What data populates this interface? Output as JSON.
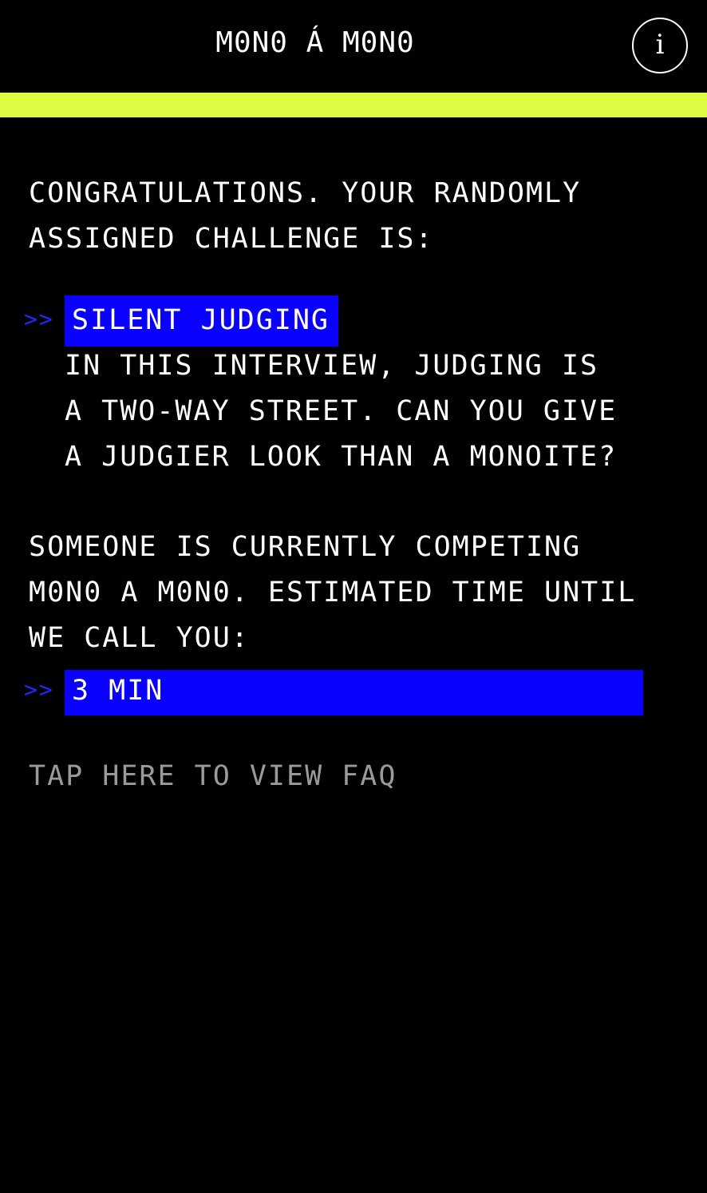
{
  "header": {
    "title": "M0N0 Á M0N0",
    "info_icon": "info-icon",
    "info_glyph": "i"
  },
  "colors": {
    "background": "#000000",
    "accent_bar": "#dcfc42",
    "highlight": "#0a00ff",
    "prompt_marker": "#1a2bff",
    "muted_text": "#9a9a9a"
  },
  "intro": {
    "lines": [
      "CONGRATULATIONS. YOUR RANDOMLY",
      "ASSIGNED CHALLENGE IS:"
    ]
  },
  "challenge": {
    "marker": ">>",
    "name": "SILENT JUDGING",
    "description_lines": [
      "IN THIS INTERVIEW, JUDGING IS",
      "A TWO-WAY STREET. CAN YOU GIVE",
      "A JUDGIER LOOK THAN A MONOITE?"
    ]
  },
  "status": {
    "lines": [
      "SOMEONE IS CURRENTLY COMPETING",
      "M0N0 A M0N0. ESTIMATED TIME UNTIL",
      "WE CALL YOU:"
    ],
    "marker": ">>",
    "wait_time": "3 MIN"
  },
  "faq": {
    "label": "TAP HERE TO VIEW FAQ"
  }
}
